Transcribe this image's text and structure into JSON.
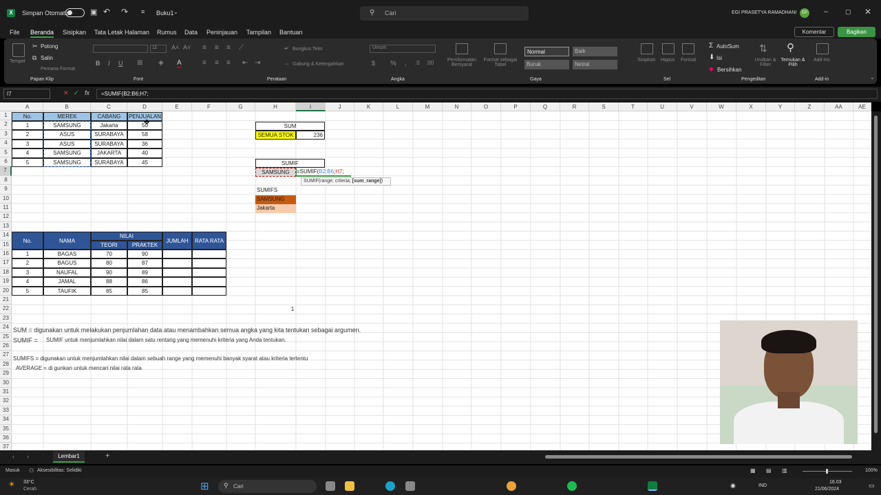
{
  "title": {
    "autosave": "Simpan Otomatis",
    "filename": "Buku1",
    "search": "Cari",
    "user": "EGI PRASETYA RAMADHANI",
    "initials": "EP"
  },
  "menu": [
    "File",
    "Beranda",
    "Sisipkan",
    "Tata Letak Halaman",
    "Rumus",
    "Data",
    "Peninjauan",
    "Tampilan",
    "Bantuan"
  ],
  "menu_right": {
    "comment": "Komentar",
    "share": "Bagikan"
  },
  "ribbon": {
    "clipboard": {
      "paste": "Tempel",
      "cut": "Potong",
      "copy": "Salin",
      "painter": "Pemana Format",
      "group": "Papan Klip"
    },
    "font": {
      "group": "Font",
      "size": "11"
    },
    "align": {
      "wrap": "Bungkus Teks",
      "merge": "Gabung & Ketengahkan",
      "group": "Perataan"
    },
    "number": {
      "format": "Umum",
      "group": "Angka"
    },
    "styles": {
      "cond": "Pemformatan Bersyarat",
      "table": "Format sebagai Tabel",
      "normal": "Normal",
      "good": "Baik",
      "bad": "Buruk",
      "neutral": "Netral",
      "group": "Gaya"
    },
    "cells": {
      "insert": "Sisipkan",
      "delete": "Hapus",
      "format": "Format",
      "group": "Sel"
    },
    "edit": {
      "autosum": "AutoSum",
      "fill": "Isi",
      "clear": "Bersihkan",
      "sort": "Urutkan & Filter",
      "find": "Temukan & Pilih",
      "group": "Pengeditan"
    },
    "addin": {
      "label": "Add-ins",
      "group": "Add-in"
    }
  },
  "formula": {
    "namebox": "I7",
    "fx": "fx",
    "content": "=SUMIF(B2:B6;H7;"
  },
  "columns": [
    "A",
    "B",
    "C",
    "D",
    "E",
    "F",
    "G",
    "H",
    "I",
    "J",
    "K",
    "L",
    "M",
    "N",
    "O",
    "P",
    "Q",
    "R",
    "S",
    "T",
    "U",
    "V",
    "W",
    "X",
    "Y",
    "Z",
    "AA",
    "AE"
  ],
  "rows": [
    "1",
    "2",
    "3",
    "4",
    "5",
    "6",
    "7",
    "8",
    "9",
    "10",
    "11",
    "12",
    "13",
    "14",
    "15",
    "16",
    "17",
    "18",
    "19",
    "20",
    "21",
    "22",
    "23",
    "24",
    "25",
    "26",
    "27",
    "28",
    "29",
    "30",
    "31",
    "32",
    "33",
    "34",
    "35",
    "36",
    "37"
  ],
  "table1": {
    "headers": [
      "No.",
      "MEREK",
      "CABANG",
      "PENJUALAN"
    ],
    "rows": [
      [
        "1",
        "SAMSUNG",
        "Jakarta",
        "50"
      ],
      [
        "2",
        "ASUS",
        "SURABAYA",
        "58"
      ],
      [
        "3",
        "ASUS",
        "SURABAYA",
        "36"
      ],
      [
        "4",
        "SAMSUNG",
        "JAKARTA",
        "40"
      ],
      [
        "5",
        "SAMSUNG",
        "SURABAYA",
        "45"
      ]
    ]
  },
  "sum_box": {
    "title": "SUM",
    "label": "SEMUA STOK",
    "value": "236"
  },
  "sumif_box": {
    "title": "SUMIF",
    "label": "SAMSUNG",
    "formula": "=SUMIF(",
    "ref1": "B2:B6",
    "sep": ";",
    "ref2": "H7",
    "end": ";",
    "tooltip_pre": "SUMIF(range; criteria; ",
    "tooltip_bold": "[sum_range]",
    "tooltip_post": ")"
  },
  "sumifs_box": {
    "title": "SUMIFS",
    "c1": "SAMSUNG",
    "c2": "Jakarta"
  },
  "table2": {
    "no": "No.",
    "nama": "NAMA",
    "nilai": "NILAI",
    "teori": "TEORI",
    "praktek": "PRAKTEK",
    "jumlah": "JUMLAH",
    "rata": "RATA RATA",
    "rows": [
      [
        "1",
        "BAGAS",
        "70",
        "90"
      ],
      [
        "2",
        "BAGUS",
        "80",
        "87"
      ],
      [
        "3",
        "NAUFAL",
        "90",
        "89"
      ],
      [
        "4",
        "JAMAL",
        "88",
        "86"
      ],
      [
        "5",
        "TAUFIK",
        "85",
        "85"
      ]
    ]
  },
  "stray": "1",
  "notes": {
    "sum": "SUM = digunakan untuk melakukan penjumlahan data atau menambahkan semua angka yang kita tentukan sebagai argumen.",
    "sumif_a": "SUMIF =",
    "sumif_b": "SUMIF untuk menjumlahkan nilai dalam satu rentang yang memenuhi kriteria yang Anda tentukan.",
    "sumifs": "SUMIFS = digunakan untuk menjumlahkan nilai dalam sebuah range yang memenuhi banyak syarat atau kriteria tertentu",
    "average": "AVERAGE = di gunkan untuk mencari nilai rata rata"
  },
  "sheet_tab": "Lembar1",
  "status": {
    "mode": "Masuk",
    "access": "Aksesibilitas: Selidiki",
    "zoom": "100%"
  },
  "taskbar": {
    "temp": "33°C",
    "weather": "Cerah",
    "search": "Cari",
    "lang": "IND",
    "time": "16.03",
    "date": "21/06/2024"
  }
}
